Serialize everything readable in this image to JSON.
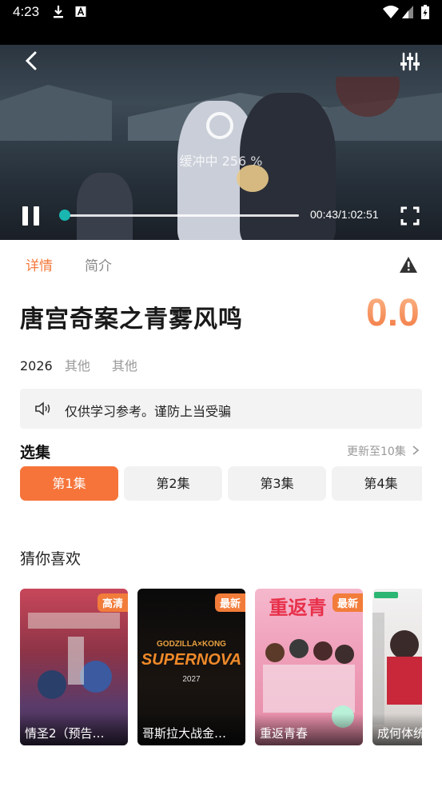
{
  "status_bar": {
    "time": "4:23"
  },
  "player": {
    "buffering_text": "缓冲中 256 %",
    "timecode": "00:43/1:02:51",
    "progress": 0.01
  },
  "tabs": [
    {
      "label": "详情"
    },
    {
      "label": "简介"
    }
  ],
  "show": {
    "title": "唐宫奇案之青雾风鸣",
    "score": "0.0",
    "year": "2026",
    "genre": "其他",
    "region": "其他"
  },
  "notice": {
    "text": "仅供学习参考。谨防上当受骗"
  },
  "episodes": {
    "section_title": "选集",
    "update_text": "更新至10集",
    "items": [
      {
        "label": "第1集"
      },
      {
        "label": "第2集"
      },
      {
        "label": "第3集"
      },
      {
        "label": "第4集"
      }
    ]
  },
  "recommendations": {
    "section_title": "猜你喜欢",
    "items": [
      {
        "title": "情圣2（预告…",
        "badge": "高清"
      },
      {
        "title": "哥斯拉大战金…",
        "badge": "最新",
        "poster_logo": "SUPERNOVA",
        "poster_sub": "GODZILLA×KONG",
        "poster_year": "2027"
      },
      {
        "title": "重返青春",
        "badge": "最新",
        "poster_text": "重返青"
      },
      {
        "title": "成何体统",
        "badge": ""
      }
    ]
  },
  "colors": {
    "accent": "#f6743a",
    "progress_thumb": "#1ab6b0"
  }
}
